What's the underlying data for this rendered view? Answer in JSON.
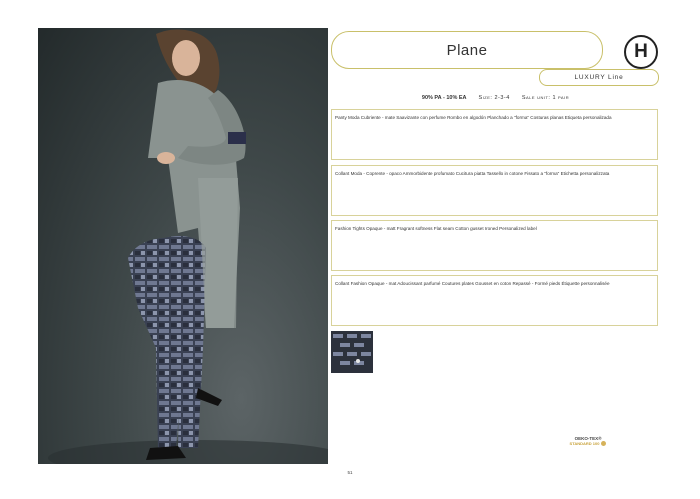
{
  "product": {
    "name": "Plane",
    "brand_logo": "H",
    "line": "LUXURY Line"
  },
  "specs": {
    "composition": "90% PA - 10% EA",
    "size": "Size: 2-3-4",
    "sale_unit": "Sale unit: 1 pair"
  },
  "descriptions": [
    "Panty Moda Cubriente - mate Saavizante con perfume Rombo en algodón Planchado a \"forma\" Costuras planas Etiqueta personalizada",
    "Collant Moda - Coprente - opaco Ammorbidente profumato Cucitura piatta Tassello in cotone Fissato a \"forma\" Etichetta personalizzata",
    "Fashion Tights Opaque - matt Fragrant softness Flat seam Cotton gusset Ironed Personalized label",
    "Collant Fashion Opaque - mat Adoucissant parfumé Coutures plates Gousset en coton Repassé - Formé pieds Étiquette personnalisée"
  ],
  "certification": {
    "name": "OEKO-TEX®",
    "standard": "STANDARD 100"
  },
  "page_number": "51",
  "colors": {
    "accent_border": "#c9c06a",
    "photo_background": "#3f4849",
    "coat": "#8a9390",
    "tights": "#3c4356"
  },
  "icons": {
    "logo": "brand-h-logo-icon",
    "oeko": "oeko-tex-badge-icon"
  }
}
